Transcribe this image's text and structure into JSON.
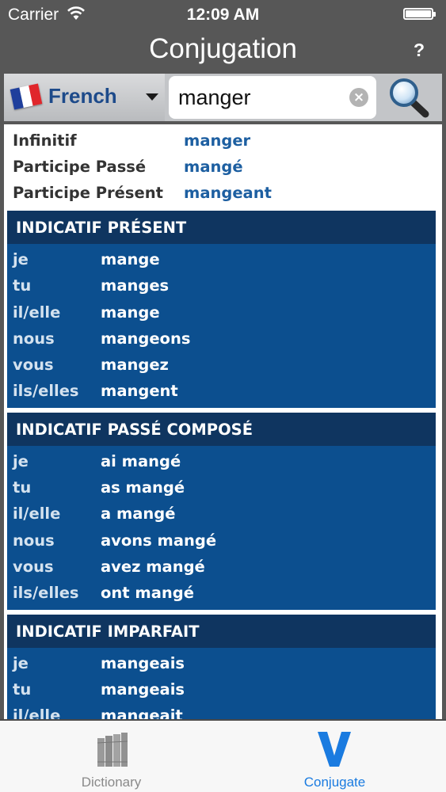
{
  "status_bar": {
    "carrier": "Carrier",
    "time": "12:09 AM"
  },
  "nav": {
    "title": "Conjugation",
    "help_label": "?"
  },
  "search": {
    "language": "French",
    "query": "manger",
    "clear_label": "×"
  },
  "forms": [
    {
      "label": "Infinitif",
      "value": "manger"
    },
    {
      "label": "Participe Passé",
      "value": "mangé"
    },
    {
      "label": "Participe Présent",
      "value": "mangeant"
    }
  ],
  "tenses": [
    {
      "title": "INDICATIF PRÉSENT",
      "rows": [
        {
          "pronoun": "je",
          "verb": "mange"
        },
        {
          "pronoun": "tu",
          "verb": "manges"
        },
        {
          "pronoun": "il/elle",
          "verb": "mange"
        },
        {
          "pronoun": "nous",
          "verb": "mangeons"
        },
        {
          "pronoun": "vous",
          "verb": "mangez"
        },
        {
          "pronoun": "ils/elles",
          "verb": "mangent"
        }
      ]
    },
    {
      "title": "INDICATIF PASSÉ COMPOSÉ",
      "rows": [
        {
          "pronoun": "je",
          "verb": "ai mangé"
        },
        {
          "pronoun": "tu",
          "verb": "as mangé"
        },
        {
          "pronoun": "il/elle",
          "verb": "a mangé"
        },
        {
          "pronoun": "nous",
          "verb": "avons mangé"
        },
        {
          "pronoun": "vous",
          "verb": "avez mangé"
        },
        {
          "pronoun": "ils/elles",
          "verb": "ont mangé"
        }
      ]
    },
    {
      "title": "INDICATIF IMPARFAIT",
      "rows": [
        {
          "pronoun": "je",
          "verb": "mangeais"
        },
        {
          "pronoun": "tu",
          "verb": "mangeais"
        },
        {
          "pronoun": "il/elle",
          "verb": "mangeait"
        }
      ]
    }
  ],
  "tab_bar": {
    "tabs": [
      {
        "label": "Dictionary",
        "icon": "books-icon",
        "selected": false
      },
      {
        "label": "Conjugate",
        "icon": "v-icon",
        "selected": true
      }
    ]
  },
  "colors": {
    "accent": "#1a7be0",
    "tense_header": "#0f3560",
    "tense_body": "#0c4f8f",
    "form_value": "#1d5fa1"
  }
}
